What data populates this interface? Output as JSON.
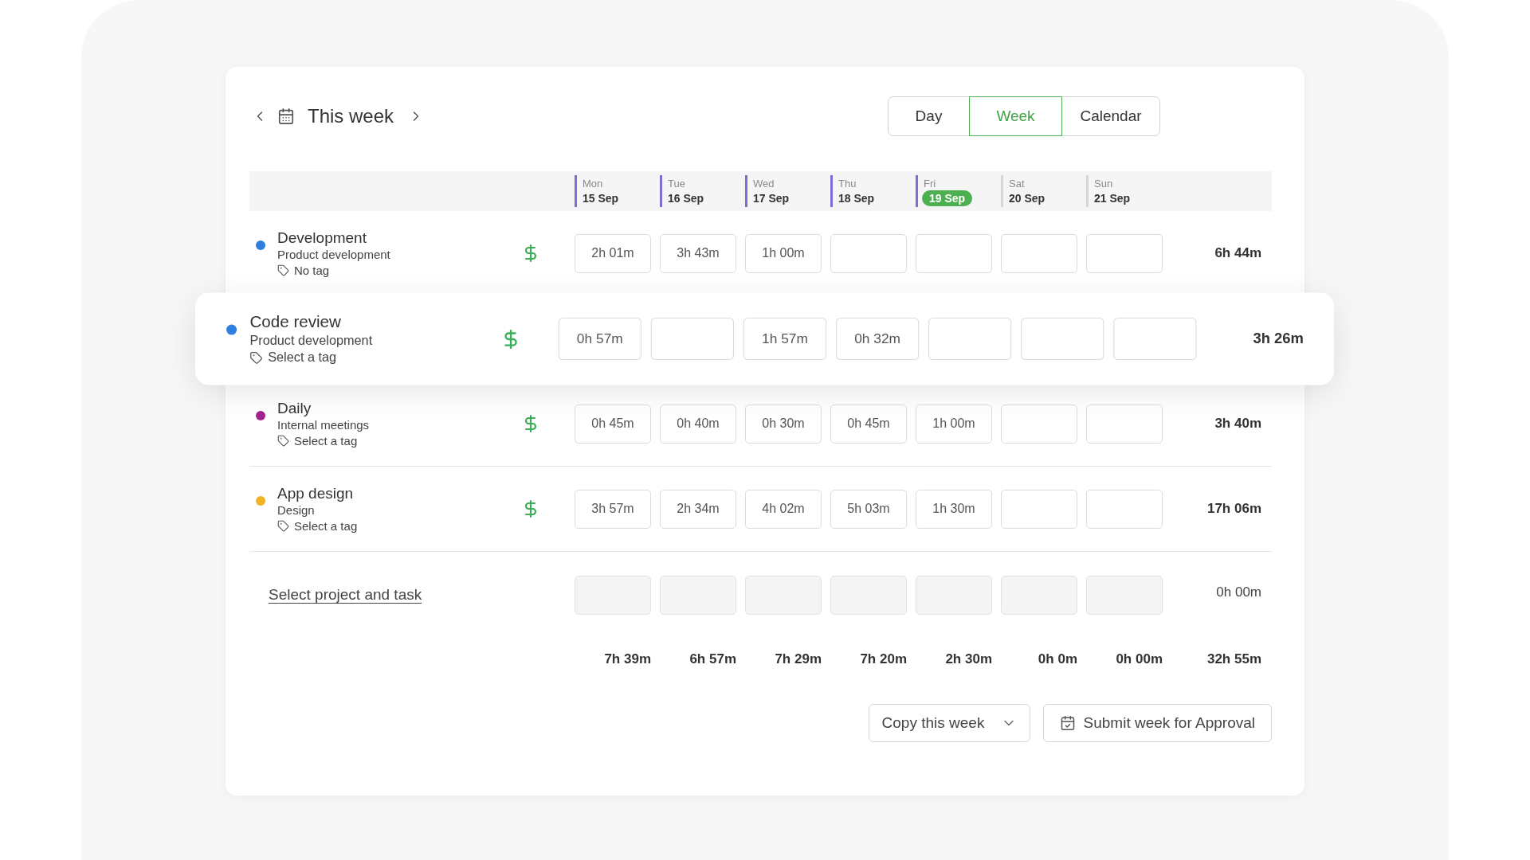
{
  "header": {
    "title": "This week"
  },
  "view_tabs": [
    {
      "label": "Day",
      "selected": false
    },
    {
      "label": "Week",
      "selected": true
    },
    {
      "label": "Calendar",
      "selected": false
    }
  ],
  "days": [
    {
      "weekday": "Mon",
      "date": "15 Sep",
      "workday": true,
      "today": false
    },
    {
      "weekday": "Tue",
      "date": "16 Sep",
      "workday": true,
      "today": false
    },
    {
      "weekday": "Wed",
      "date": "17 Sep",
      "workday": true,
      "today": false
    },
    {
      "weekday": "Thu",
      "date": "18 Sep",
      "workday": true,
      "today": false
    },
    {
      "weekday": "Fri",
      "date": "19 Sep",
      "workday": true,
      "today": true
    },
    {
      "weekday": "Sat",
      "date": "20 Sep",
      "workday": false,
      "today": false
    },
    {
      "weekday": "Sun",
      "date": "21 Sep",
      "workday": false,
      "today": false
    }
  ],
  "rows": [
    {
      "title": "Development",
      "project": "Product development",
      "tag": "No tag",
      "color": "#2f7fe0",
      "billable": true,
      "highlighted": false,
      "cells": [
        "2h 01m",
        "3h 43m",
        "1h 00m",
        null,
        null,
        null,
        null
      ],
      "total": "6h 44m"
    },
    {
      "title": "Code review",
      "project": "Product development",
      "tag": "Select a tag",
      "color": "#2f7fe0",
      "billable": true,
      "highlighted": true,
      "cells": [
        "0h 57m",
        null,
        "1h 57m",
        "0h 32m",
        null,
        null,
        null
      ],
      "total": "3h 26m"
    },
    {
      "title": "Daily",
      "project": "Internal meetings",
      "tag": "Select a tag",
      "color": "#a3238f",
      "billable": true,
      "highlighted": false,
      "cells": [
        "0h 45m",
        "0h 40m",
        "0h 30m",
        "0h 45m",
        "1h 00m",
        null,
        null
      ],
      "total": "3h 40m"
    },
    {
      "title": "App design",
      "project": "Design",
      "tag": "Select a tag",
      "color": "#f0b323",
      "billable": true,
      "highlighted": false,
      "cells": [
        "3h 57m",
        "2h 34m",
        "4h 02m",
        "5h 03m",
        "1h 30m",
        null,
        null
      ],
      "total": "17h 06m"
    }
  ],
  "new_entry": {
    "label": "Select project and task",
    "cells": [
      {
        "disabled": true
      },
      {
        "disabled": true
      },
      {
        "disabled": true
      },
      {
        "disabled": true
      },
      {
        "disabled": true
      },
      {
        "disabled": true
      },
      {
        "disabled": true
      }
    ],
    "total": "0h 00m"
  },
  "day_totals": [
    "7h 39m",
    "6h 57m",
    "7h 29m",
    "7h 20m",
    "2h 30m",
    "0h 0m",
    "0h 00m"
  ],
  "grand_total": "32h 55m",
  "actions": {
    "copy": "Copy this week",
    "submit": "Submit week for Approval"
  }
}
